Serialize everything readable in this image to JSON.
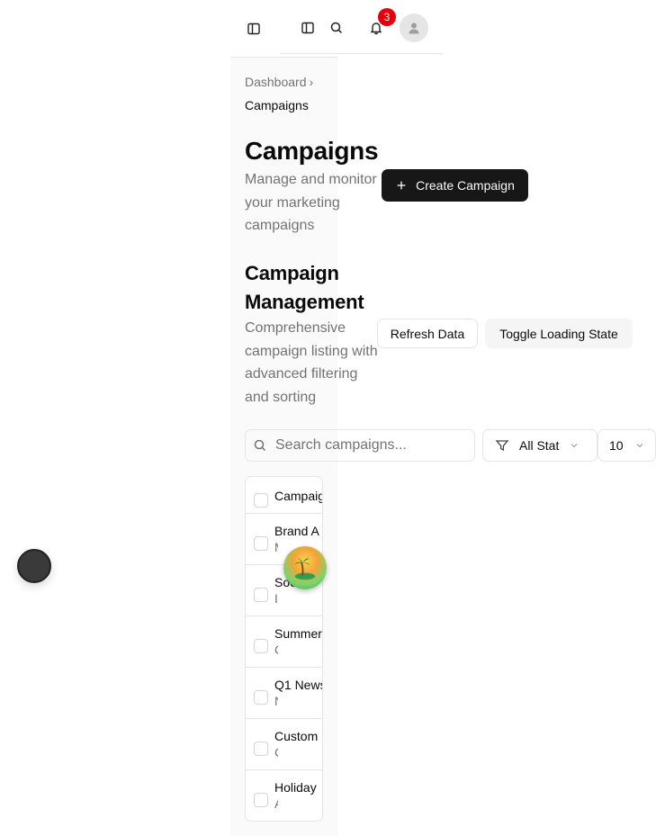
{
  "topbar": {
    "notification_count": "3"
  },
  "breadcrumb": {
    "parent": "Dashboard",
    "separator": "›",
    "current": "Campaigns"
  },
  "page": {
    "title": "Campaigns",
    "subtitle": "Manage and monitor your marketing campaigns",
    "create_button": "Create Campaign"
  },
  "section": {
    "title": "Campaign Management",
    "subtitle": "Comprehensive campaign listing with advanced filtering and sorting",
    "refresh_button": "Refresh Data",
    "toggle_button": "Toggle Loading State"
  },
  "filters": {
    "search_placeholder": "Search campaigns...",
    "status_value": "All Stat",
    "rows_value": "10"
  },
  "table": {
    "header": "Campaig",
    "rows": [
      {
        "name": "Brand A",
        "sub": "M"
      },
      {
        "name": "Soc",
        "sub": "I"
      },
      {
        "name": "Summer",
        "sub": "C"
      },
      {
        "name": "Q1 News",
        "sub": "N"
      },
      {
        "name": "Custom",
        "sub": "C"
      },
      {
        "name": "Holiday",
        "sub": "A"
      }
    ]
  },
  "colors": {
    "primary": "#171717",
    "badge": "#e7000b",
    "muted_text": "#737373",
    "border": "#e5e5e5"
  }
}
